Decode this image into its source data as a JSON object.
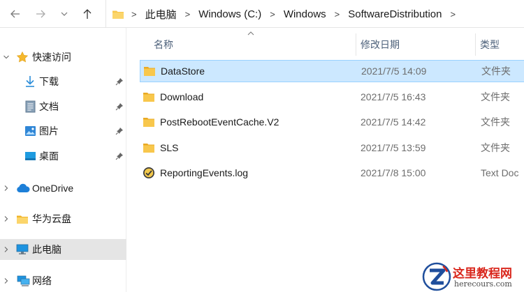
{
  "address_bar": {
    "breadcrumbs": [
      "此电脑",
      "Windows (C:)",
      "Windows",
      "SoftwareDistribution"
    ],
    "separator": ">"
  },
  "sidebar": {
    "items": [
      {
        "label": "快速访问",
        "icon": "star-icon"
      },
      {
        "label": "下载",
        "icon": "download-icon",
        "pinned": true
      },
      {
        "label": "文档",
        "icon": "document-icon",
        "pinned": true
      },
      {
        "label": "图片",
        "icon": "picture-icon",
        "pinned": true
      },
      {
        "label": "桌面",
        "icon": "desktop-icon",
        "pinned": true
      },
      {
        "label": "OneDrive",
        "icon": "cloud-icon"
      },
      {
        "label": "华为云盘",
        "icon": "folder-icon"
      },
      {
        "label": "此电脑",
        "icon": "computer-icon",
        "active": true
      },
      {
        "label": "网络",
        "icon": "network-icon"
      }
    ]
  },
  "columns": {
    "name": "名称",
    "date": "修改日期",
    "type": "类型"
  },
  "files": [
    {
      "name": "DataStore",
      "date": "2021/7/5 14:09",
      "type": "文件夹",
      "icon": "folder-icon",
      "selected": true
    },
    {
      "name": "Download",
      "date": "2021/7/5 16:43",
      "type": "文件夹",
      "icon": "folder-icon"
    },
    {
      "name": "PostRebootEventCache.V2",
      "date": "2021/7/5 14:42",
      "type": "文件夹",
      "icon": "folder-icon"
    },
    {
      "name": "SLS",
      "date": "2021/7/5 13:59",
      "type": "文件夹",
      "icon": "folder-icon"
    },
    {
      "name": "ReportingEvents.log",
      "date": "2021/7/8 15:00",
      "type": "Text Doc",
      "icon": "log-file-icon"
    }
  ],
  "watermark": {
    "title": "这里教程网",
    "url": "herecours.com"
  },
  "colors": {
    "selection_bg": "#cce8ff",
    "selection_border": "#99d1ff",
    "folder_yellow": "#f8c74c",
    "header_text": "#4c607a",
    "watermark_red": "#d9261c"
  }
}
